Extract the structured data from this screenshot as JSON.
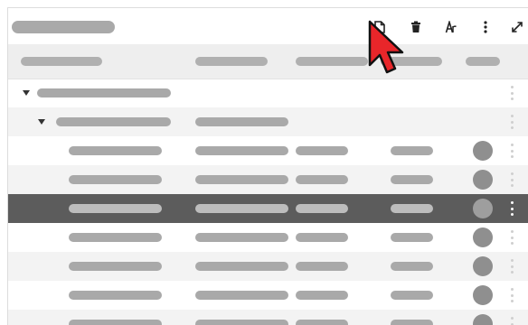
{
  "toolbar": {
    "title_placeholder": true,
    "icons": [
      "new-file-icon",
      "trash-icon",
      "text-format-icon",
      "more-vertical-icon",
      "expand-icon"
    ]
  },
  "table": {
    "header_cells": 5,
    "rows": [
      {
        "kind": "group",
        "level": 1,
        "expanded": true
      },
      {
        "kind": "group",
        "level": 2,
        "expanded": true
      },
      {
        "kind": "item"
      },
      {
        "kind": "item"
      },
      {
        "kind": "item",
        "selected": true
      },
      {
        "kind": "item"
      },
      {
        "kind": "item"
      },
      {
        "kind": "item"
      },
      {
        "kind": "item"
      }
    ]
  },
  "colors": {
    "selected_row": "#5c5c5c",
    "placeholder": "#a9a9a9",
    "cursor": "#e8262a"
  }
}
